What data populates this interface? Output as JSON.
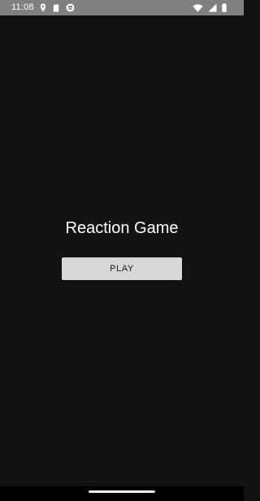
{
  "status_bar": {
    "time": "11:08",
    "left_icons": [
      "location-pin-icon",
      "sd-card-icon",
      "app-notification-icon"
    ],
    "right_icons": [
      "wifi-icon",
      "signal-icon",
      "battery-icon"
    ]
  },
  "app": {
    "title": "Reaction Game",
    "play_label": "PLAY"
  },
  "colors": {
    "background": "#121212",
    "status_bar": "#808080",
    "button_bg": "#d6d7d7",
    "button_text": "#1d1d1d",
    "nav_bar": "#000000"
  }
}
